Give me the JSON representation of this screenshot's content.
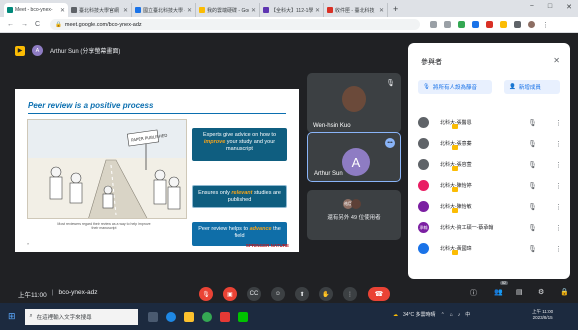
{
  "browser": {
    "tabs": [
      {
        "title": "Meet - bco-ynex-",
        "active": true,
        "color": "#00897b"
      },
      {
        "title": "臺北科技大學官網",
        "active": false,
        "color": "#5f6368"
      },
      {
        "title": "國立臺北科技大學 - ",
        "active": false,
        "color": "#1a73e8"
      },
      {
        "title": "我的雲端硬碟 - Goo",
        "active": false,
        "color": "#fbbc04"
      },
      {
        "title": "【全科大】112-1學",
        "active": false,
        "color": "#5e35b1"
      },
      {
        "title": "收件匣 - 臺北科技",
        "active": false,
        "color": "#d93025"
      }
    ],
    "tab_close_glyph": "✕",
    "new_tab_glyph": "+",
    "window_controls": [
      "−",
      "□",
      "✕"
    ],
    "nav": {
      "back": "←",
      "forward": "→",
      "reload": "C"
    },
    "url": "meet.google.com/bco-ynex-adz"
  },
  "meet": {
    "presenter_label": "Arthur Sun (分享螢幕畫面)",
    "presenter_initial": "A",
    "slide": {
      "title": "Peer review is a positive process",
      "cartoon_sign": "PAPER PUBLISHED",
      "caption": "Most reviewers regard their review as a way to help improve their manuscript",
      "box1_pre": "Experts give advice on how to ",
      "box1_em": "improve",
      "box1_post": " your study and your manuscript",
      "box2_pre": "Ensures only ",
      "box2_em": "relevant",
      "box2_post": " studies are published",
      "box3_pre": "Peer review helps to ",
      "box3_em": "advance",
      "box3_post": " the field",
      "brand": "SPRINGER NATURE",
      "page": "»"
    },
    "tiles": [
      {
        "name": "Wen-hsin Kuo"
      },
      {
        "name": "Arthur Sun",
        "initial": "A"
      },
      {
        "name": "",
        "others_label": "還有另外 49 位使用者"
      }
    ],
    "others_avatars": [
      "祐臣",
      "",
      ""
    ],
    "panel": {
      "title": "參與者",
      "mute_all": "將所有人設為靜音",
      "add_people": "新增成員",
      "participants": [
        {
          "name": "北科大-張醫恩",
          "avatar_color": "#5f6368",
          "initial": ""
        },
        {
          "name": "北科大-張意蓁",
          "avatar_color": "#5f6368",
          "initial": ""
        },
        {
          "name": "北科大-張容萱",
          "avatar_color": "#5f6368",
          "initial": ""
        },
        {
          "name": "北科大-陳怡婷",
          "avatar_color": "#e91e63",
          "initial": ""
        },
        {
          "name": "北科大-陳怡敏",
          "avatar_color": "#7b1fa2",
          "initial": ""
        },
        {
          "name": "北科大-資工碩一-蔡承翰",
          "avatar_color": "#7b1fa2",
          "initial": "承翰"
        },
        {
          "name": "北科大-黃國瑋",
          "avatar_color": "#1a73e8",
          "initial": ""
        }
      ]
    },
    "bottom": {
      "time": "上午11:00",
      "separator": "|",
      "code": "bco-ynex-adz",
      "participant_count": "52"
    }
  },
  "taskbar": {
    "search_placeholder": "在這裡輸入文字來搜尋",
    "weather": "34°C 多雲時晴",
    "lang": "中",
    "time": "上午 11:00",
    "date": "2023/8/15"
  }
}
